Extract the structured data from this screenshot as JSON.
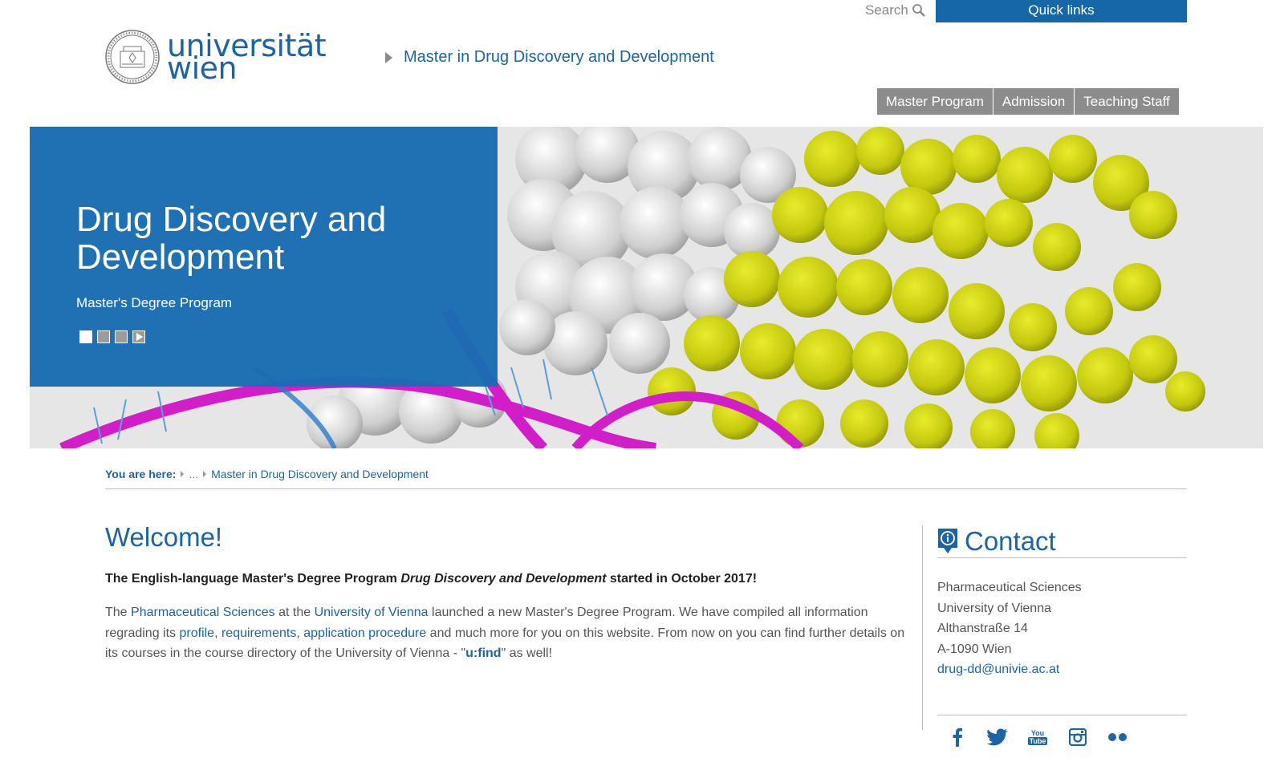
{
  "header": {
    "search_label": "Search",
    "quicklinks_label": "Quick links",
    "logo_line1": "universität",
    "logo_line2": "wien",
    "site_title": "Master in Drug Discovery and Development"
  },
  "nav": {
    "items": [
      {
        "label": "Master Program"
      },
      {
        "label": "Admission"
      },
      {
        "label": "Teaching Staff"
      }
    ]
  },
  "hero": {
    "title": "Drug Discovery and Development",
    "subtitle": "Master's Degree Program",
    "slides_active": 1,
    "slides_total": 3
  },
  "breadcrumb": {
    "label": "You are here:",
    "ellipsis": "...",
    "current": "Master in Drug Discovery and Development"
  },
  "main": {
    "heading": "Welcome!",
    "lead_pre": "The English-language Master's Degree Program ",
    "lead_em": "Drug Discovery and Development",
    "lead_post": " started in October 2017!",
    "body": {
      "t1": "The ",
      "l1": "Pharmaceutical Sciences",
      "t2": " at the ",
      "l2": "University of Vienna",
      "t3": " launched a new Master's Degree Program. We have compiled all information regrading its ",
      "l3": "profile",
      "t4": ", ",
      "l4": "requirements",
      "t5": ", ",
      "l5": "application procedure",
      "t6": " and much more for you on this website. From now on you can find further details on its courses in the course directory of the University of Vienna - \"",
      "l6": "u:find",
      "t7": "\" as well!"
    }
  },
  "contact": {
    "heading": "Contact",
    "line1": "Pharmaceutical Sciences",
    "line2": "University of Vienna",
    "line3": "Althanstraße 14",
    "line4": "A-1090 Wien",
    "email": "drug-dd@univie.ac.at",
    "youtube_top": "You",
    "youtube_bottom": "Tube"
  },
  "colors": {
    "brand_blue": "#1b64a6",
    "hero_panel": "#186cb2",
    "nav_gray": "#8c8c8c",
    "protein_yellow": "#c9cf10",
    "dna_magenta": "#d21ec8"
  },
  "icons": [
    "search-icon",
    "university-seal-icon",
    "chevron-right-icon",
    "info-icon",
    "facebook-icon",
    "twitter-icon",
    "youtube-icon",
    "instagram-icon",
    "flickr-icon"
  ]
}
